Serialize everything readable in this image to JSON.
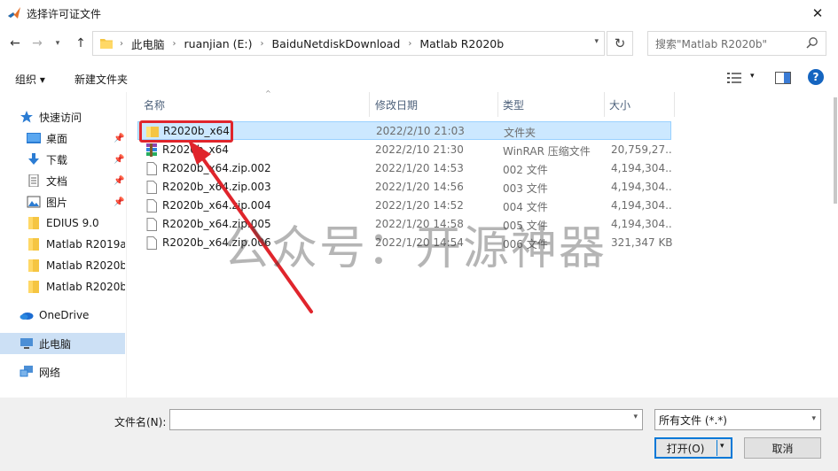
{
  "window": {
    "title": "选择许可证文件",
    "close_glyph": "✕"
  },
  "nav": {
    "breadcrumbs": [
      "此电脑",
      "ruanjian (E:)",
      "BaiduNetdiskDownload",
      "Matlab R2020b"
    ],
    "search_placeholder": "搜索\"Matlab R2020b\""
  },
  "toolbar": {
    "organize": "组织 ▾",
    "new_folder": "新建文件夹"
  },
  "sidebar": {
    "quick_access": "快速访问",
    "quick_items": [
      "桌面",
      "下载",
      "文档",
      "图片",
      "EDIUS 9.0",
      "Matlab R2019a",
      "Matlab R2020b",
      "Matlab R2020b"
    ],
    "onedrive": "OneDrive",
    "this_pc": "此电脑",
    "network": "网络"
  },
  "columns": {
    "name": "名称",
    "date": "修改日期",
    "type": "类型",
    "size": "大小"
  },
  "files": [
    {
      "name": "R2020b_x64",
      "date": "2022/2/10 21:03",
      "type": "文件夹",
      "size": "",
      "icon": "folder-icon"
    },
    {
      "name": "R2020b_x64",
      "date": "2022/2/10 21:30",
      "type": "WinRAR 压缩文件",
      "size": "20,759,27...",
      "icon": "rar-archive-icon"
    },
    {
      "name": "R2020b_x64.zip.002",
      "date": "2022/1/20 14:53",
      "type": "002 文件",
      "size": "4,194,304...",
      "icon": "file-icon"
    },
    {
      "name": "R2020b_x64.zip.003",
      "date": "2022/1/20 14:56",
      "type": "003 文件",
      "size": "4,194,304...",
      "icon": "file-icon"
    },
    {
      "name": "R2020b_x64.zip.004",
      "date": "2022/1/20 14:52",
      "type": "004 文件",
      "size": "4,194,304...",
      "icon": "file-icon"
    },
    {
      "name": "R2020b_x64.zip.005",
      "date": "2022/1/20 14:58",
      "type": "005 文件",
      "size": "4,194,304...",
      "icon": "file-icon"
    },
    {
      "name": "R2020b_x64.zip.006",
      "date": "2022/1/20 14:54",
      "type": "006 文件",
      "size": "321,347 KB",
      "icon": "file-icon"
    }
  ],
  "watermark": "公众号：开源神器",
  "bottom": {
    "filename_label": "文件名(N):",
    "filename_value": "",
    "filetype_value": "所有文件 (*.*)",
    "open_label": "打开(O)",
    "cancel_label": "取消"
  },
  "colors": {
    "annotation_red": "#e0252c",
    "selection_blue": "#cce8ff",
    "accent": "#0078d7"
  }
}
